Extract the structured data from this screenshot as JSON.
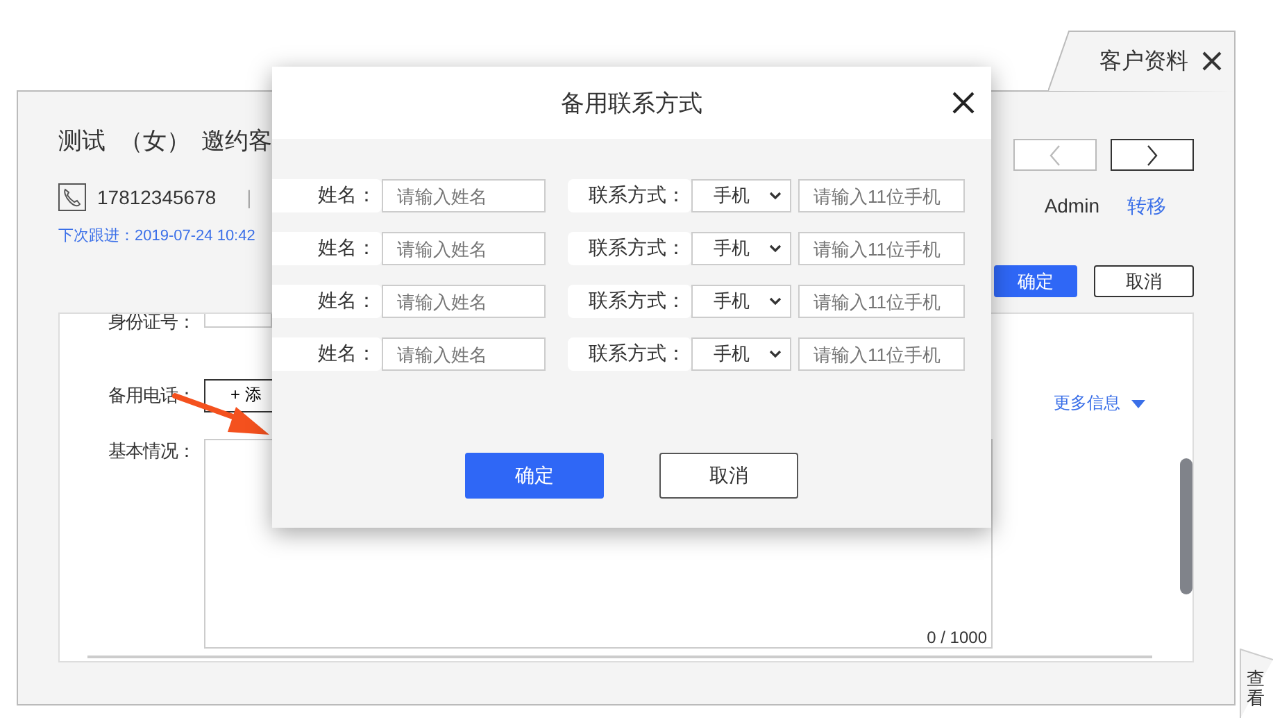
{
  "tab": {
    "title": "客户资料"
  },
  "customer": {
    "name": "测试",
    "gender": "（女）",
    "status": "邀约客",
    "phone": "17812345678",
    "separator": "|",
    "next_follow_up": "下次跟进：2019-07-24 10:42"
  },
  "nav": {
    "prev_disabled": true,
    "next_disabled": false
  },
  "owner": {
    "name": "Admin",
    "transfer": "转移"
  },
  "header_buttons": [
    {
      "label": "确定",
      "kind": "primary"
    },
    {
      "label": "取消",
      "kind": "secondary"
    }
  ],
  "form": {
    "id_label": "身份证号：",
    "backup_phone_label": "备用电话：",
    "add_button": "+ 添",
    "basic_label": "基本情况：",
    "char_count": "0 / 1000",
    "more_info": "更多信息"
  },
  "modal": {
    "title": "备用联系方式",
    "rows": [
      {
        "name_label": "姓名：",
        "name_placeholder": "请输入姓名",
        "contact_label": "联系方式：",
        "contact_type": "手机",
        "phone_placeholder": "请输入11位手机"
      },
      {
        "name_label": "姓名：",
        "name_placeholder": "请输入姓名",
        "contact_label": "联系方式：",
        "contact_type": "手机",
        "phone_placeholder": "请输入11位手机"
      },
      {
        "name_label": "姓名：",
        "name_placeholder": "请输入姓名",
        "contact_label": "联系方式：",
        "contact_type": "手机",
        "phone_placeholder": "请输入11位手机"
      },
      {
        "name_label": "姓名：",
        "name_placeholder": "请输入姓名",
        "contact_label": "联系方式：",
        "contact_type": "手机",
        "phone_placeholder": "请输入11位手机"
      }
    ],
    "buttons": [
      {
        "label": "确定",
        "kind": "primary"
      },
      {
        "label": "取消",
        "kind": "secondary"
      }
    ]
  },
  "side_tab": {
    "label": "查看"
  }
}
